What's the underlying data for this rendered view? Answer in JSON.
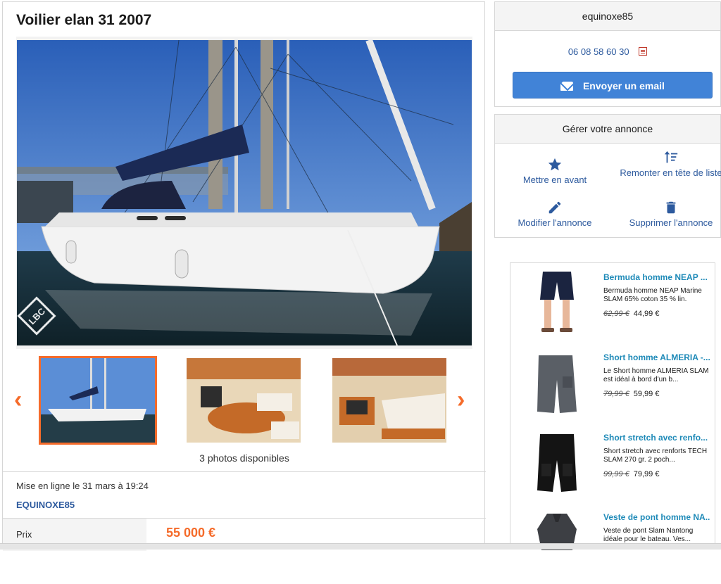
{
  "listing": {
    "title": "Voilier elan 31 2007",
    "photos_count": "3 photos disponibles",
    "posted": "Mise en ligne le 31 mars à 19:24",
    "seller_name": "EQUINOXE85",
    "watermark": "LBC",
    "price_label": "Prix",
    "price_value": "55 000 €"
  },
  "gallery": {
    "prev_icon": "chevron-left-icon",
    "next_icon": "chevron-right-icon",
    "thumbnails": [
      {
        "subject": "sailboat exterior",
        "active": true
      },
      {
        "subject": "cabin interior salon",
        "active": false
      },
      {
        "subject": "cabin interior seating",
        "active": false
      }
    ]
  },
  "user": {
    "username": "equinoxe85",
    "phone": "06 08 58 60 30",
    "email_button": "Envoyer un email"
  },
  "manage": {
    "title": "Gérer votre annonce",
    "actions": [
      {
        "label": "Mettre en avant",
        "icon": "star-icon"
      },
      {
        "label": "Remonter en tête de liste",
        "icon": "sort-up-icon"
      },
      {
        "label": "Modifier l'annonce",
        "icon": "pencil-icon"
      },
      {
        "label": "Supprimer l'annonce",
        "icon": "trash-icon"
      }
    ]
  },
  "ads": [
    {
      "title": "Bermuda homme NEAP ...",
      "desc": "Bermuda homme NEAP Marine SLAM 65% coton 35 % lin.",
      "old_price": "62,99 €",
      "price": "44,99 €"
    },
    {
      "title": "Short homme ALMERIA -...",
      "desc": "Le Short homme ALMERIA SLAM est idéal à bord d'un b...",
      "old_price": "79,99 €",
      "price": "59,99 €"
    },
    {
      "title": "Short stretch avec renfo...",
      "desc": "Short stretch avec renforts TECH SLAM 270 gr. 2 poch...",
      "old_price": "99,99 €",
      "price": "79,99 €"
    },
    {
      "title": "Veste de pont homme NA...",
      "desc": "Veste de pont Slam Nantong idéale pour le bateau. Ves...",
      "old_price": "",
      "price": ""
    }
  ],
  "colors": {
    "accent_orange": "#f56b2a",
    "link_blue": "#2d5a9e",
    "button_blue": "#4183d7",
    "ad_title_blue": "#1e8ab8"
  }
}
